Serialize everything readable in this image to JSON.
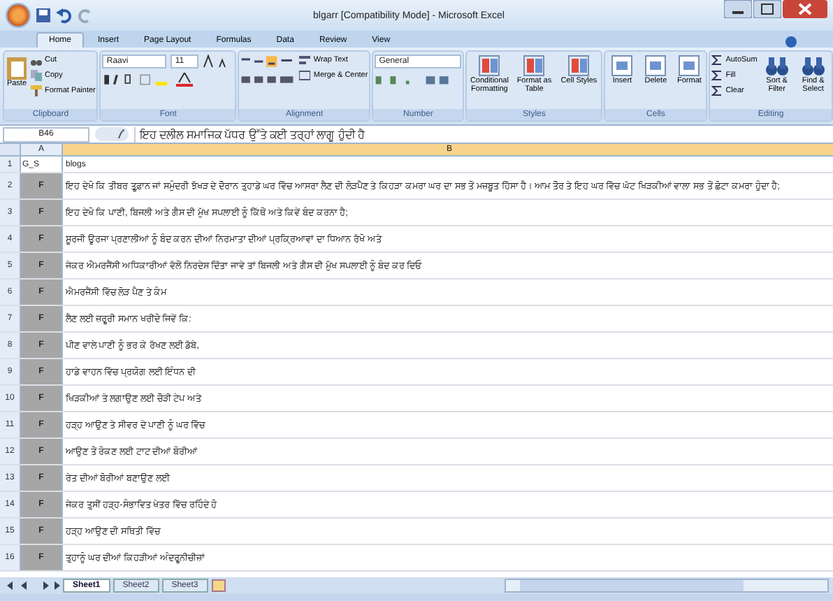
{
  "window": {
    "title": "blgarr [Compatibility Mode] - Microsoft Excel"
  },
  "tabs": [
    {
      "label": "Home",
      "selected": true
    },
    {
      "label": "Insert",
      "selected": false
    },
    {
      "label": "Page Layout",
      "selected": false
    },
    {
      "label": "Formulas",
      "selected": false
    },
    {
      "label": "Data",
      "selected": false
    },
    {
      "label": "Review",
      "selected": false
    },
    {
      "label": "View",
      "selected": false
    }
  ],
  "ribbon": {
    "clipboard": {
      "label": "Clipboard",
      "paste": "Paste",
      "cut": "Cut",
      "copy": "Copy",
      "format_painter": "Format Painter"
    },
    "font": {
      "label": "Font",
      "name": "Raavi",
      "size": "11"
    },
    "alignment": {
      "label": "Alignment",
      "wrap": "Wrap Text",
      "merge": "Merge & Center"
    },
    "number": {
      "label": "Number",
      "format": "General"
    },
    "styles": {
      "label": "Styles",
      "buttons": [
        "Conditional Formatting",
        "Format as Table",
        "Cell Styles"
      ]
    },
    "cells": {
      "label": "Cells",
      "buttons": [
        "Insert",
        "Delete",
        "Format"
      ]
    },
    "editing": {
      "label": "Editing",
      "small": [
        "AutoSum",
        "Fill",
        "Clear"
      ],
      "buttons": [
        "Sort & Filter",
        "Find & Select"
      ]
    }
  },
  "formula_bar": {
    "name_box": "B46",
    "formula": "ਇਹ ਦਲੀਲ ਸਮਾਜਿਕ ਪੱਧਰ ਉੱਤੇ ਕਈ ਤਰ੍ਹਾਂ ਲਾਗੂ ਹੁੰਦੀ ਹੈ"
  },
  "columns": [
    {
      "label": "A",
      "selected": false
    },
    {
      "label": "B",
      "selected": true
    }
  ],
  "rows": [
    {
      "num": "1",
      "a": "G_S",
      "b": "blogs"
    },
    {
      "num": "2",
      "a": "F",
      "b": "ਇਹ ਦੇਖੋ ਕਿ ਤੀਬਰ ਤੂਫ਼ਾਨ ਜਾਂ ਸਮੁੰਦਰੀ ਝੱਖੜ ਦੇ ਦੌਰਾਨ ਤੁਹਾਡੇ ਘਰ ਵਿੱਚ ਆਸਰਾ ਲੈਣ ਦੀ ਲੋੜਪੈਣ ਤੇ ਕਿਹੜਾ ਕਮਰਾ ਘਰ ਦਾ ਸਭ ਤੋਂ ਮਜ਼ਬੂਤ ਹਿੱਸਾ ਹੈ। ਆਮ ਤੌਰ ਤੇ ਇਹ ਘਰ ਵਿੱਚ ਘੱਟ ਖਿੜਕੀਆਂ ਵਾਲਾ ਸਭ ਤੋਂ ਛੋਟਾ ਕਮਰਾ ਹੁੰਦਾ ਹੈ;"
    },
    {
      "num": "3",
      "a": "F",
      "b": "ਇਹ ਦੇਖੋ ਕਿ ਪਾਣੀ, ਬਿਜਲੀ ਅਤੇ ਗੈਸ ਦੀ ਮੁੱਖ ਸਪਲਾਈ ਨੂੰ ਕਿੱਥੋਂ ਅਤੇ ਕਿਵੇਂ ਬੰਦ ਕਰਨਾ ਹੈ;"
    },
    {
      "num": "4",
      "a": "F",
      "b": "ਸੂਰਜੀ ਊਰਜਾ ਪ੍ਰਣਾਲੀਆਂ ਨੂੰ ਬੰਦ ਕਰਨ ਦੀਆਂ ਨਿਰਮਾਤਾ ਦੀਆਂ ਪ੍ਰਕ੍ਰਿਆਵਾਂ ਦਾ ਧਿਆਨ ਰੱਖੋ ਅਤੇ"
    },
    {
      "num": "5",
      "a": "F",
      "b": "ਜੇਕਰ ਐਮਰਜੈਂਸੀ ਅਧਿਕਾਰੀਆਂ ਵੱਲੋਂ ਨਿਰਦੇਸ਼ ਦਿੱਤਾ ਜਾਵੇ ਤਾਂ ਬਿਜਲੀ ਅਤੇ ਗੈਸ ਦੀ ਮੁੱਖ ਸਪਲਾਈ ਨੂੰ ਬੰਦ ਕਰ ਦਿਓ"
    },
    {
      "num": "6",
      "a": "F",
      "b": "ਐਮਰਜੈਂਸੀ ਵਿੱਚ ਲੋੜ ਪੈਣ ਤੇ ਕੰਮ"
    },
    {
      "num": "7",
      "a": "F",
      "b": "ਲੈਣ ਲਈ ਜ਼ਰੂਰੀ ਸਮਾਨ ਖਰੀਦੋ ਜਿਵੇਂ ਕਿ:"
    },
    {
      "num": "8",
      "a": "F",
      "b": "ਪੀਣ ਵਾਲੇ ਪਾਣੀ ਨੂੰ ਭਰ ਕੇ ਰੱਖਣ ਲਈ ਡੱਬੇ,"
    },
    {
      "num": "9",
      "a": "F",
      "b": "ਹਾਡੇ ਵਾਹਨ ਵਿੱਚ ਪ੍ਰਯੋਗ ਲਈ ਇੰਧਨ ਦੀ"
    },
    {
      "num": "10",
      "a": "F",
      "b": "ਖਿੜਕੀਆਂ ਤੇ ਲਗਾਉਣ ਲਈ ਚੌੜੀ ਟੇਪ ਅਤੇ"
    },
    {
      "num": "11",
      "a": "F",
      "b": "ਹੜ੍ਹ ਆਉਣ ਤੇ ਸੀਵਰ ਦੇ ਪਾਣੀ ਨੂੰ ਘਰ ਵਿੱਚ"
    },
    {
      "num": "12",
      "a": "F",
      "b": "ਆਉਣ ਤੋਂ ਰੋਕਣ ਲਈ ਟਾਟ ਦੀਆਂ ਬੋਰੀਆਂ"
    },
    {
      "num": "13",
      "a": "F",
      "b": "ਰੇਤ ਦੀਆਂ ਬੋਰੀਆਂ ਬਣਾਉਣ ਲਈ"
    },
    {
      "num": "14",
      "a": "F",
      "b": "ਜੇਕਰ ਤੁਸੀਂ ਹੜ੍ਹ-ਸੰਭਾਵਿਤ ਖੇਤਰ ਵਿੱਚ ਰਹਿੰਦੇ ਹੋ"
    },
    {
      "num": "15",
      "a": "F",
      "b": "ਹੜ੍ਹ ਆਉਣ ਦੀ ਸਥਿਤੀ ਵਿੱਚ"
    },
    {
      "num": "16",
      "a": "F",
      "b": "ਤੁਹਾਨੂੰ ਘਰ ਦੀਆਂ ਕਿਹੜੀਆਂ ਅੰਦਰੂਨੀਚੀਜ਼ਾਂ"
    }
  ],
  "sheets": [
    {
      "label": "Sheet1",
      "selected": true
    },
    {
      "label": "Sheet2",
      "selected": false
    },
    {
      "label": "Sheet3",
      "selected": false
    }
  ]
}
